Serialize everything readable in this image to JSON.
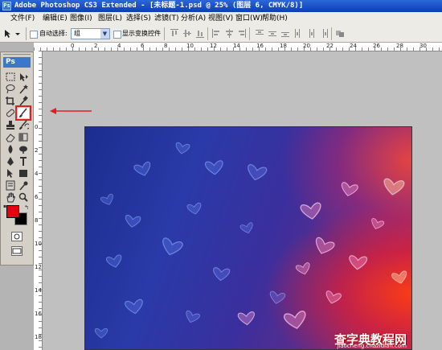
{
  "window": {
    "title": "Adobe Photoshop CS3 Extended - [未标题-1.psd @ 25% (图层 6, CMYK/8)]"
  },
  "menu": [
    {
      "label": "文件(F)"
    },
    {
      "label": "编辑(E)"
    },
    {
      "label": "图像(I)"
    },
    {
      "label": "图层(L)"
    },
    {
      "label": "选择(S)"
    },
    {
      "label": "滤镜(T)"
    },
    {
      "label": "分析(A)"
    },
    {
      "label": "视图(V)"
    },
    {
      "label": "窗口(W)"
    },
    {
      "label": "帮助(H)"
    }
  ],
  "options": {
    "auto_select_label": "自动选择:",
    "auto_select_value": "组",
    "show_transform_label": "显示变换控件"
  },
  "toolbox": {
    "logo": "Ps",
    "foreground_color": "#e60012",
    "background_color": "#000000",
    "active_tool": "brush-tool"
  },
  "rulers": {
    "top": [
      "0",
      "2",
      "4",
      "6",
      "8",
      "10",
      "12",
      "14",
      "16",
      "18",
      "20",
      "22",
      "24",
      "26",
      "28",
      "30"
    ],
    "left": [
      "0",
      "2",
      "4",
      "6",
      "8",
      "10",
      "12",
      "14",
      "16",
      "18",
      "20",
      "22"
    ]
  },
  "watermark": {
    "text": "查字典教程网",
    "url": "jiaocheng.chazidian.com"
  }
}
